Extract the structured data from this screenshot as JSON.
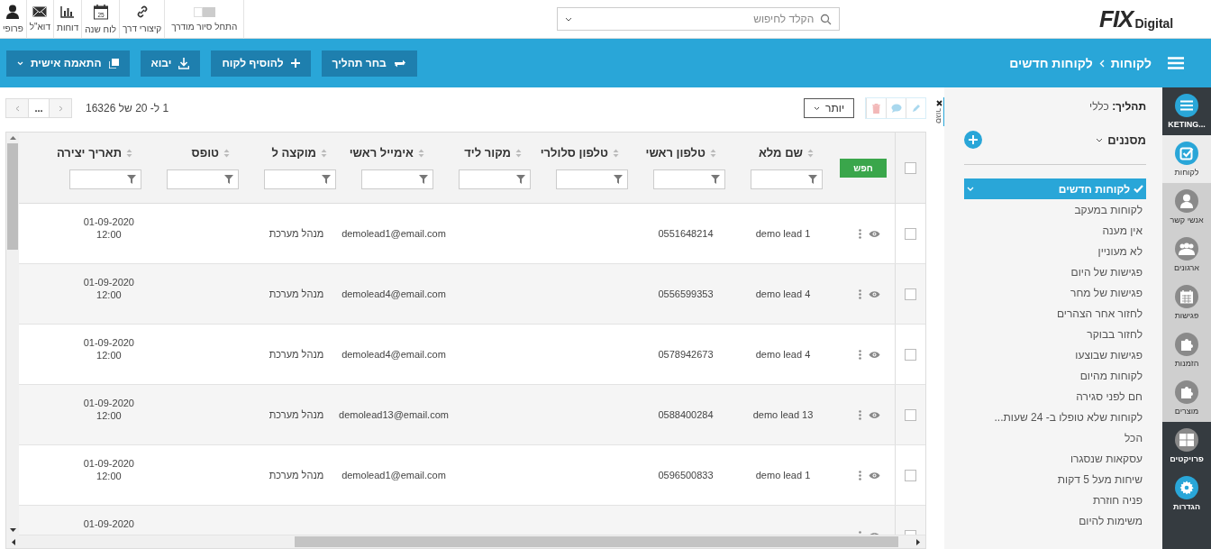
{
  "logo": {
    "mark": "FIX",
    "word": "Digital"
  },
  "search": {
    "placeholder": "הקלד לחיפוש"
  },
  "toolbar": [
    {
      "kind": "toggle",
      "label": "התחל סיור מודרך",
      "on": false
    },
    {
      "kind": "link",
      "label": "קיצורי דרך"
    },
    {
      "kind": "calendar",
      "label": "לוח שנה",
      "day": "25"
    },
    {
      "kind": "chart",
      "label": "דוחות"
    },
    {
      "kind": "mail",
      "label": "דוא\"ל"
    },
    {
      "kind": "person",
      "label": "פרופי"
    }
  ],
  "breadcrumb": [
    "לקוחות",
    "לקוחות חדשים"
  ],
  "actions": [
    {
      "kind": "process",
      "label": "בחר תהליך"
    },
    {
      "kind": "add",
      "label": "להוסיף לקוח"
    },
    {
      "kind": "import",
      "label": "יבוא"
    },
    {
      "kind": "custom",
      "label": "התאמה אישית"
    }
  ],
  "more_button": "יותר",
  "pagination": {
    "summary": "1 ל- 20 של 16326",
    "middle": "..."
  },
  "table": {
    "search_button": "חפש",
    "all_checked": false,
    "columns": [
      "שם מלא",
      "טלפון ראשי",
      "טלפון סלולרי",
      "מקור ליד",
      "אימייל ראשי",
      "מוקצה ל",
      "טופס",
      "תאריך יצירה"
    ],
    "rows": [
      {
        "checked": false,
        "cells": [
          "demo lead 1",
          "0551648214",
          "",
          "",
          "demolead1@email.com",
          "מנהל מערכת",
          "",
          "01-09-2020",
          "12:00"
        ]
      },
      {
        "checked": false,
        "cells": [
          "demo lead 4",
          "0556599353",
          "",
          "",
          "demolead4@email.com",
          "מנהל מערכת",
          "",
          "01-09-2020",
          "12:00"
        ]
      },
      {
        "checked": false,
        "cells": [
          "demo lead 4",
          "0578942673",
          "",
          "",
          "demolead4@email.com",
          "מנהל מערכת",
          "",
          "01-09-2020",
          "12:00"
        ]
      },
      {
        "checked": false,
        "cells": [
          "demo lead 13",
          "0588400284",
          "",
          "",
          "demolead13@email.com",
          "מנהל מערכת",
          "",
          "01-09-2020",
          "12:00"
        ]
      },
      {
        "checked": false,
        "cells": [
          "demo lead 1",
          "0596500833",
          "",
          "",
          "demolead1@email.com",
          "מנהל מערכת",
          "",
          "01-09-2020",
          "12:00"
        ]
      },
      {
        "checked": false,
        "cells": [
          "",
          "",
          "",
          "",
          "",
          "",
          "",
          "01-09-2020",
          ""
        ]
      }
    ]
  },
  "collapse_tab": "סגור",
  "sidebar": {
    "process": "**תהליך:** כללי",
    "filters_title": "מסננים",
    "items": [
      {
        "label": "לקוחות חדשים",
        "selected": true
      },
      {
        "label": "לקוחות במעקב",
        "selected": false
      },
      {
        "label": "אין מענה",
        "selected": false
      },
      {
        "label": "לא מעוניין",
        "selected": false
      },
      {
        "label": "פגישות של היום",
        "selected": false
      },
      {
        "label": "פגישות של מחר",
        "selected": false
      },
      {
        "label": "לחזור אחר הצהרים",
        "selected": false
      },
      {
        "label": "לחזור בבוקר",
        "selected": false
      },
      {
        "label": "פגישות שבוצעו",
        "selected": false
      },
      {
        "label": "לקוחות מהיום",
        "selected": false
      },
      {
        "label": "חם לפני סגירה",
        "selected": false
      },
      {
        "label": "לקוחות שלא טופלו ב- 24 שעות...",
        "selected": false
      },
      {
        "label": "הכל",
        "selected": false
      },
      {
        "label": "עסקאות שנסגרו",
        "selected": false
      },
      {
        "label": "שיחות מעל 5 דקות",
        "selected": false
      },
      {
        "label": "פניה חוזרת",
        "selected": false
      },
      {
        "label": "משימות להיום",
        "selected": false
      }
    ]
  },
  "nav_groups": [
    {
      "kind": "dark",
      "items": [
        {
          "kind": "menu",
          "label": "...KETING",
          "color": "#29a6d8",
          "selected": false
        }
      ]
    },
    {
      "kind": "grey",
      "items": [
        {
          "kind": "check",
          "label": "לקוחות",
          "color": "#29a6d8",
          "selected": true
        },
        {
          "kind": "person",
          "label": "אנשי קשר",
          "color": "#8a8a8a",
          "selected": false
        },
        {
          "kind": "group",
          "label": "ארגונים",
          "color": "#8a8a8a",
          "selected": false
        },
        {
          "kind": "calendar",
          "label": "פגישות",
          "color": "#8a8a8a",
          "selected": false
        },
        {
          "kind": "puzzle",
          "label": "הזמנות",
          "color": "#8a8a8a",
          "selected": false
        },
        {
          "kind": "puzzle",
          "label": "מוצרים",
          "color": "#8a8a8a",
          "selected": false
        }
      ]
    },
    {
      "kind": "dark",
      "items": [
        {
          "kind": "grid",
          "label": "פרויקטים",
          "color": "#8a8a8a",
          "selected": false
        },
        {
          "kind": "gear",
          "label": "הגדרות",
          "color": "#29a6d8",
          "selected": false
        }
      ]
    }
  ]
}
